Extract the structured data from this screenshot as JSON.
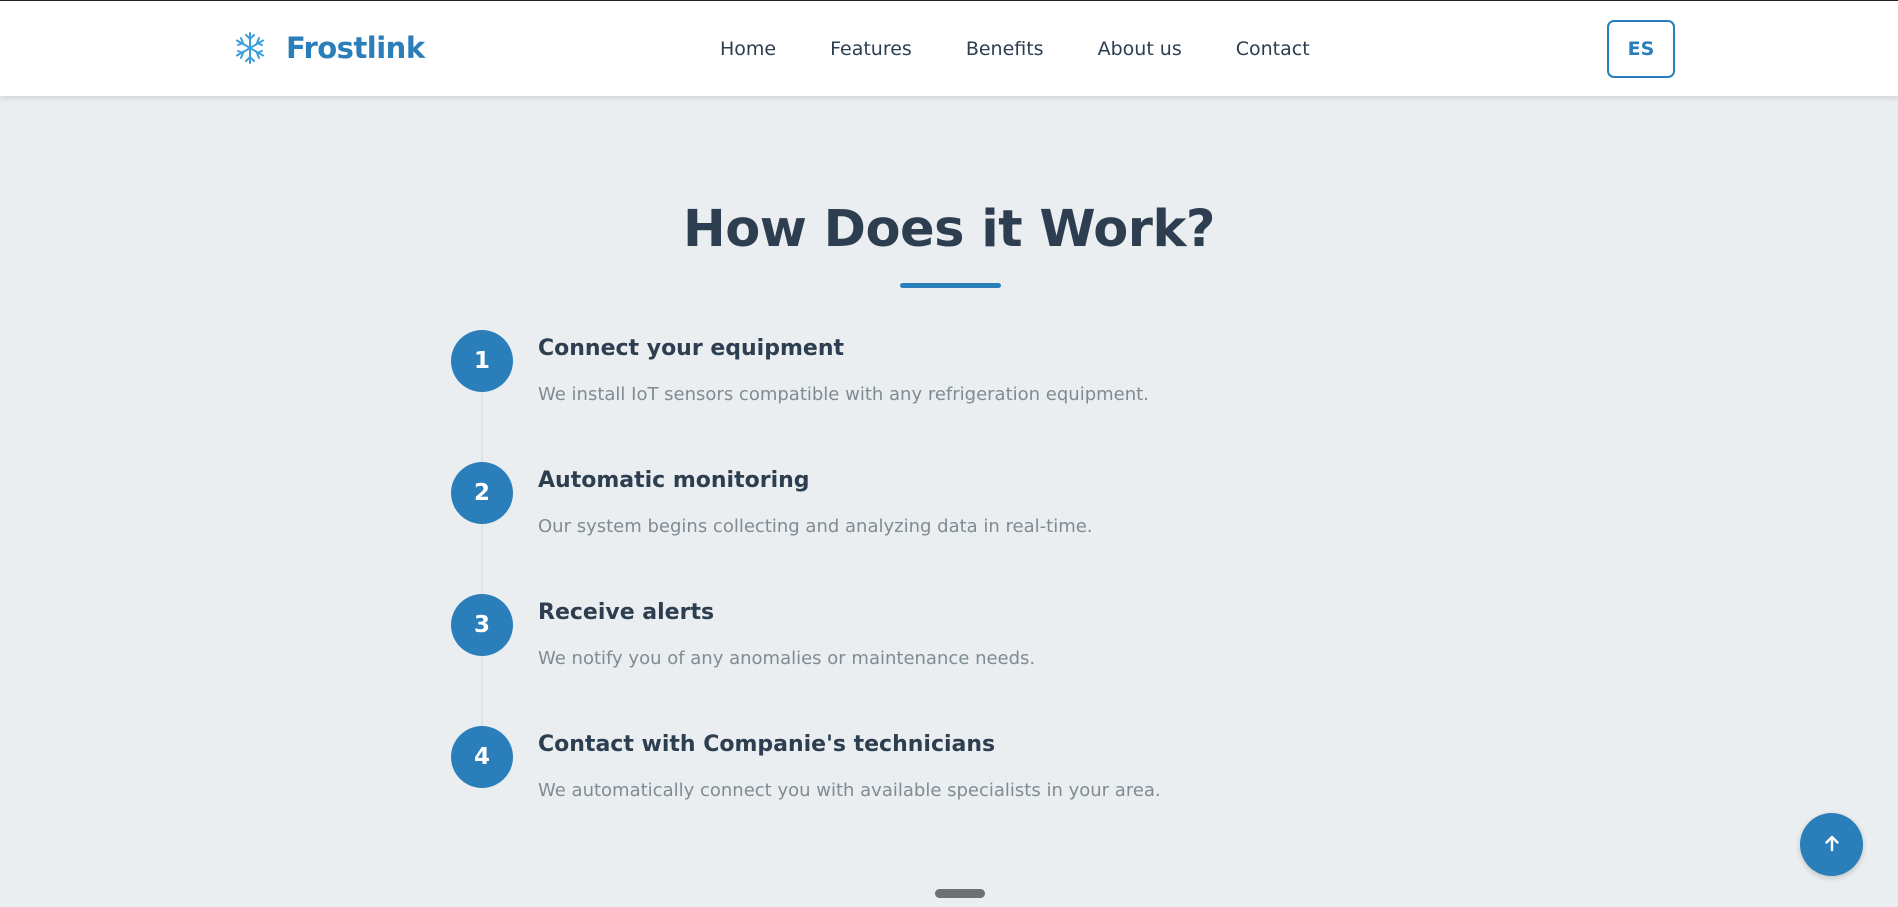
{
  "header": {
    "brand_name": "Frostlink",
    "brand_icon": "snowflake-icon",
    "nav": [
      {
        "label": "Home"
      },
      {
        "label": "Features"
      },
      {
        "label": "Benefits"
      },
      {
        "label": "About us"
      },
      {
        "label": "Contact"
      }
    ],
    "language_button": "ES"
  },
  "section": {
    "title": "How Does it Work?",
    "steps": [
      {
        "number": "1",
        "title": "Connect your equipment",
        "description": "We install IoT sensors compatible with any refrigeration equipment."
      },
      {
        "number": "2",
        "title": "Automatic monitoring",
        "description": "Our system begins collecting and analyzing data in real-time."
      },
      {
        "number": "3",
        "title": "Receive alerts",
        "description": "We notify you of any anomalies or maintenance needs."
      },
      {
        "number": "4",
        "title": "Contact with Companie's technicians",
        "description": "We automatically connect you with available specialists in your area."
      }
    ]
  },
  "back_to_top_icon": "arrow-up-icon",
  "colors": {
    "accent": "#2a7fba",
    "heading": "#2c3e50",
    "muted": "#7f8c93",
    "page_background": "#ebeef0"
  }
}
